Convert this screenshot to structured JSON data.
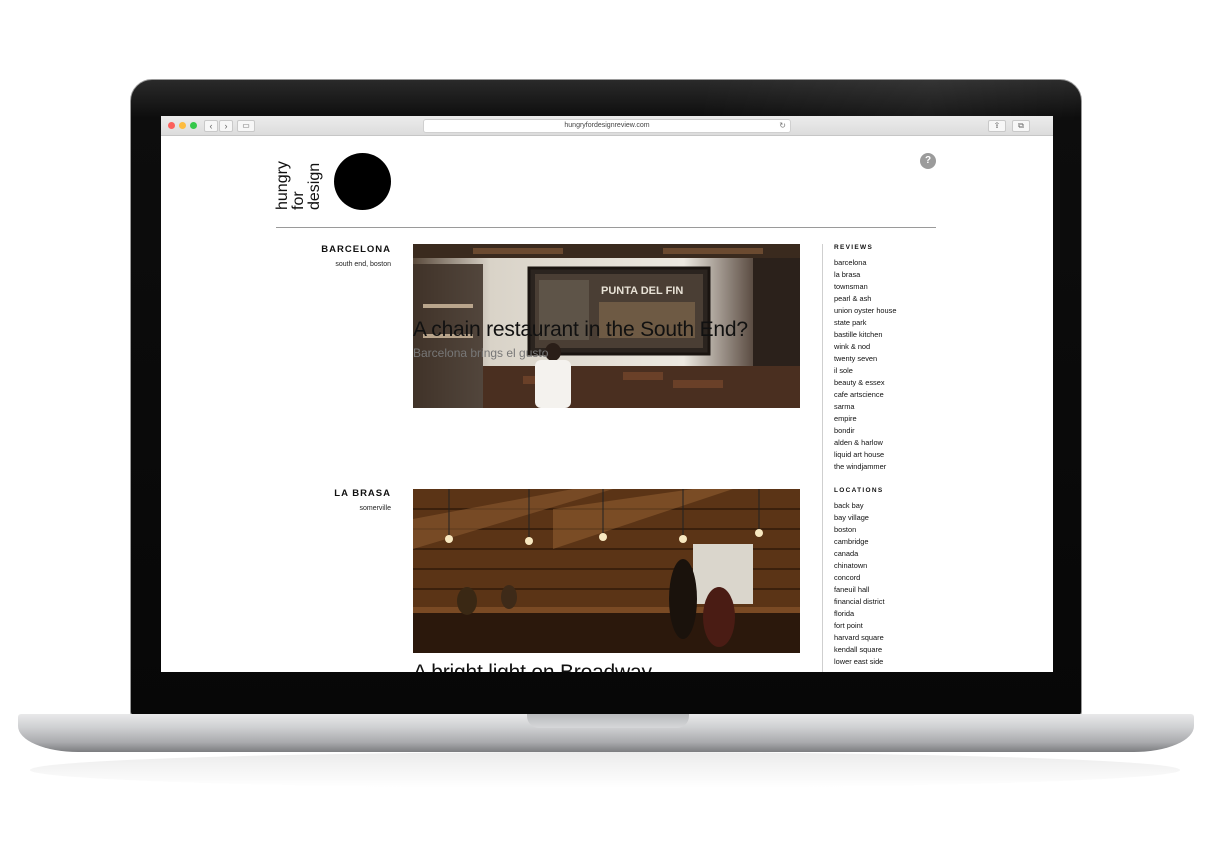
{
  "browser": {
    "url": "hungryfordesignreview.com",
    "back_glyph": "‹",
    "forward_glyph": "›",
    "sidebar_glyph": "▭",
    "reload_glyph": "↻",
    "share_glyph": "⇪",
    "tabs_glyph": "⧉",
    "newtab_glyph": "+"
  },
  "logo": {
    "line1": "hungry",
    "line2": "for",
    "line3": "design"
  },
  "help": {
    "glyph": "?"
  },
  "entries": [
    {
      "name": "BARCELONA",
      "location": "south end, boston",
      "headline": "A chain restaurant in the South End?",
      "subhead": "Barcelona brings el gusto",
      "photo_sign": "PUNTA DEL FIN"
    },
    {
      "name": "LA BRASA",
      "location": "somerville",
      "headline": "A bright light on Broadway",
      "subhead": ""
    }
  ],
  "sidebar": {
    "reviews_heading": "REVIEWS",
    "reviews": [
      "barcelona",
      "la brasa",
      "townsman",
      "pearl & ash",
      "union oyster house",
      "state park",
      "bastille kitchen",
      "wink & nod",
      "twenty seven",
      "il sole",
      "beauty & essex",
      "cafe artscience",
      "sarma",
      "empire",
      "bondir",
      "alden & harlow",
      "liquid art house",
      "the windjammer"
    ],
    "locations_heading": "LOCATIONS",
    "locations": [
      "back bay",
      "bay village",
      "boston",
      "cambridge",
      "canada",
      "chinatown",
      "concord",
      "faneuil hall",
      "financial district",
      "florida",
      "fort point",
      "harvard square",
      "kendall square",
      "lower east side"
    ]
  },
  "colors": {
    "logo_circle": "#000000",
    "help_icon": "#9b9b9b",
    "subhead": "#777777"
  }
}
